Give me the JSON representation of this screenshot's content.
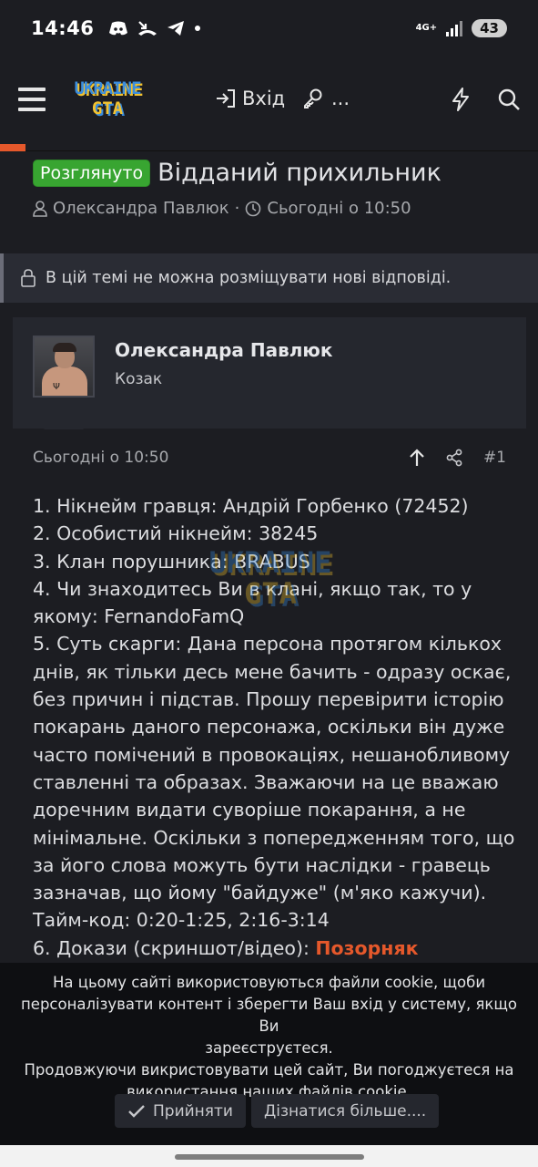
{
  "status_bar": {
    "time": "14:46",
    "net_top": "4G+",
    "battery": "43"
  },
  "header": {
    "logo_line1": "UKRAINE",
    "logo_line2": "GTA",
    "login_label": "Вхід",
    "register_label": "..."
  },
  "thread": {
    "badge": "Розглянуто",
    "title": "Відданий прихильник",
    "author": "Олександра Павлюк",
    "separator": "·",
    "date": "Сьогодні о 10:50"
  },
  "locked_notice": "В цій темі не можна розміщувати нові відповіді.",
  "post": {
    "user_name": "Олександра Павлюк",
    "user_title": "Козак",
    "date": "Сьогодні о 10:50",
    "number": "#1",
    "lines": [
      "1. Нікнейм гравця: Андрій Горбенко (72452)",
      "2. Особистий нікнейм: 38245",
      "3. Клан порушника: BRABUS",
      "4. Чи знаходитесь Ви в клані, якщо так, то у",
      "якому: FernandoFamQ",
      "5. Суть скарги: Дана персона протягом кількох",
      "днів, як тільки десь мене бачить - одразу оскає,",
      "без причин і підстав. Прошу перевірити історію",
      "покарань даного персонажа, оскільки він дуже",
      "часто помічений в провокаціях, нешанобливому",
      "ставленні та образах. Зважаючи на це вважаю",
      "доречним видати суворіше покарання, а не",
      "мінімальне. Оскільки з попередженням того, що",
      "за його слова можуть бути наслідки - гравець",
      "зазначав, що йому \"байдуже\" (м'яко кажучи).",
      "Тайм-код: 0:20-1:25, 2:16-3:14"
    ],
    "evidence_label": "6. Докази (скриншот/відео): ",
    "evidence_link": "Позорняк"
  },
  "cookie": {
    "text1": "На цьому сайті використовуються файли cookie, щоби",
    "text2": "персоналізувати контент і зберегти Ваш вхід у систему, якщо Ви",
    "text3": "зареєструєтеся.",
    "text4": "Продовжуючи викристовувати цей сайт, Ви погоджуєтеся на",
    "text5": "використання наших файлів cookie.",
    "accept_label": "Прийняти",
    "learn_more_label": "Дізнатися більше...."
  },
  "colors": {
    "accent_orange": "#e5582b",
    "badge_green": "#38a531",
    "background": "#1c1d22"
  }
}
